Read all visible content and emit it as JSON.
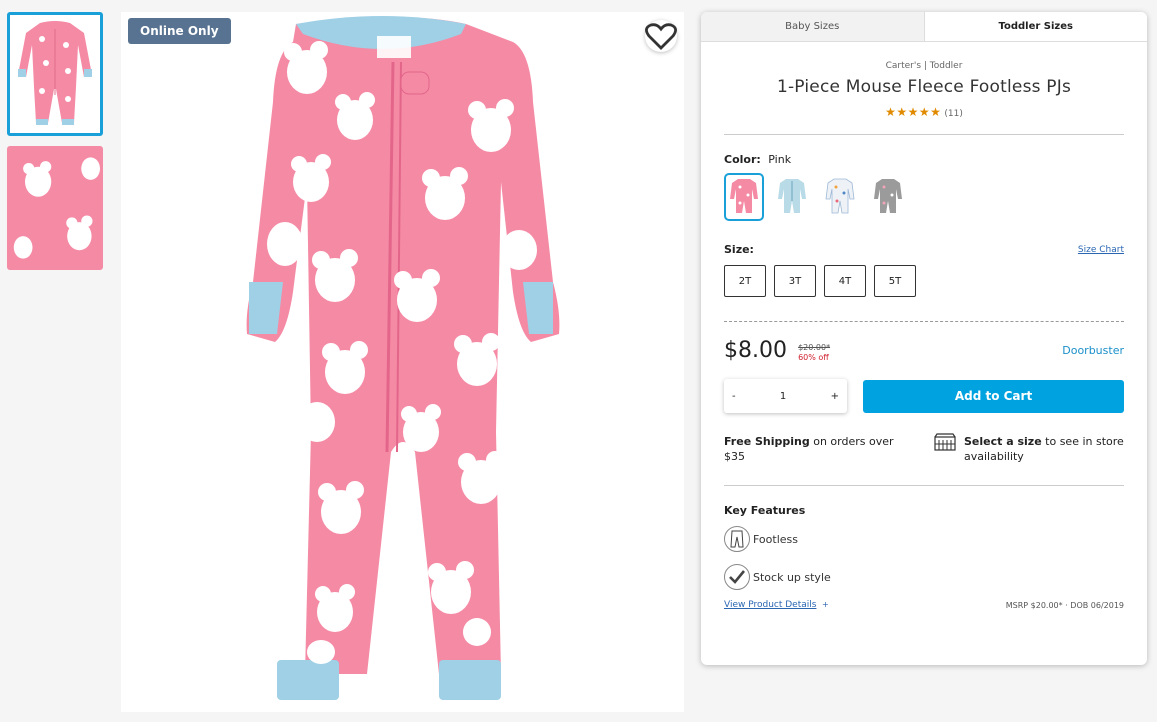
{
  "badges": {
    "online_only": "Online Only"
  },
  "tabs": [
    {
      "label": "Baby Sizes",
      "active": false
    },
    {
      "label": "Toddler Sizes",
      "active": true
    }
  ],
  "product": {
    "brand_line": "Carter's | Toddler",
    "title": "1-Piece Mouse Fleece Footless PJs",
    "rating_stars": "★★★★★",
    "rating_count": "(11)",
    "rating_value": 5
  },
  "color": {
    "label": "Color:",
    "selected": "Pink",
    "swatches": [
      {
        "name": "pink-mouse",
        "color": "#f58aa5",
        "active": true
      },
      {
        "name": "blue-stripe",
        "color": "#b9dbe8",
        "active": false
      },
      {
        "name": "white-print",
        "color": "#e9eef4",
        "active": false
      },
      {
        "name": "grey-heart",
        "color": "#9b9b9b",
        "active": false
      }
    ]
  },
  "size": {
    "label": "Size:",
    "chart_link": "Size Chart",
    "options": [
      "2T",
      "3T",
      "4T",
      "5T"
    ]
  },
  "price": {
    "current": "$8.00",
    "original": "$20.00*",
    "discount": "60% off",
    "promo": "Doorbuster"
  },
  "cart": {
    "minus": "-",
    "quantity": "1",
    "plus": "+",
    "add_label": "Add to Cart"
  },
  "shipping": {
    "free_bold": "Free Shipping",
    "free_rest": " on orders over $35",
    "store_bold": "Select a size",
    "store_rest": " to see in store availability"
  },
  "features": {
    "title": "Key Features",
    "items": [
      "Footless",
      "Stock up style"
    ]
  },
  "footer": {
    "details_link": "View Product Details",
    "details_plus": "+",
    "msrp": "MSRP $20.00* · DOB 06/2019"
  },
  "colors": {
    "accent": "#00a3e0",
    "selected_border": "#1aa0d8",
    "badge_bg": "#587391",
    "sale_red": "#d0202e",
    "star": "#e08a00",
    "pajama_pink": "#f58aa5",
    "cuff_blue": "#9fd0e6"
  }
}
